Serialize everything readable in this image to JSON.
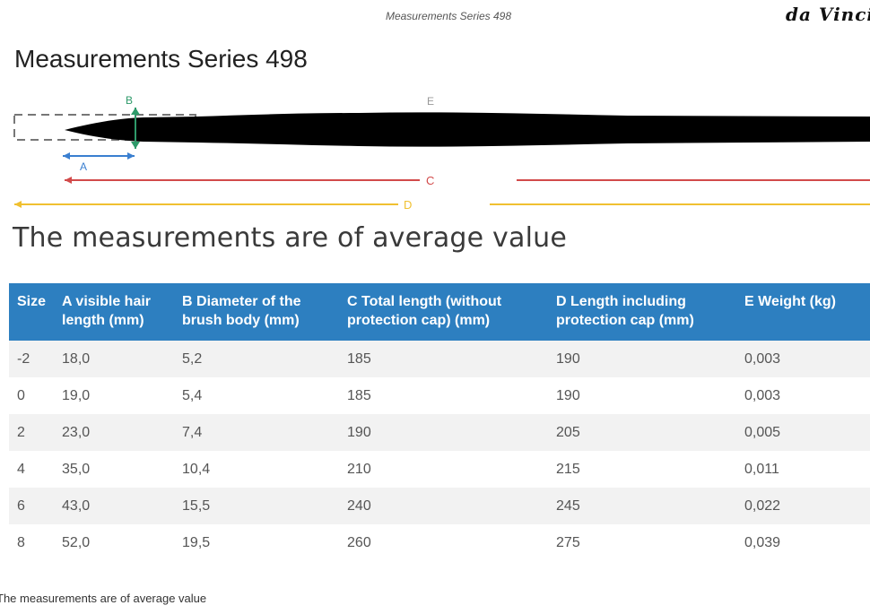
{
  "header": {
    "caption": "Measurements Series 498",
    "logo_text": "da Vinci"
  },
  "page_title": "Measurements Series 498",
  "diagram": {
    "labels": {
      "a": "A",
      "b": "B",
      "c": "C",
      "d": "D",
      "e": "E"
    },
    "colors": {
      "brush": "#000000",
      "a_arrow": "#3a7fd0",
      "b_marker": "#2e9a6a",
      "c_arrow": "#d24a4a",
      "d_arrow": "#f0c030",
      "e_label": "#999999",
      "cap_dash": "#777777"
    }
  },
  "subtitle": "The measurements are of average value",
  "table": {
    "header_color": "#2d7fc0",
    "columns": [
      "Size",
      "A visible hair length (mm)",
      "B Diameter of the brush body (mm)",
      "C Total length (without protection cap) (mm)",
      "D Length including protection cap (mm)",
      "E Weight (kg)"
    ],
    "rows": [
      [
        "-2",
        "18,0",
        "5,2",
        "185",
        "190",
        "0,003"
      ],
      [
        "0",
        "19,0",
        "5,4",
        "185",
        "190",
        "0,003"
      ],
      [
        "2",
        "23,0",
        "7,4",
        "190",
        "205",
        "0,005"
      ],
      [
        "4",
        "35,0",
        "10,4",
        "210",
        "215",
        "0,011"
      ],
      [
        "6",
        "43,0",
        "15,5",
        "240",
        "245",
        "0,022"
      ],
      [
        "8",
        "52,0",
        "19,5",
        "260",
        "275",
        "0,039"
      ]
    ]
  },
  "footnote": "The measurements are of average value"
}
